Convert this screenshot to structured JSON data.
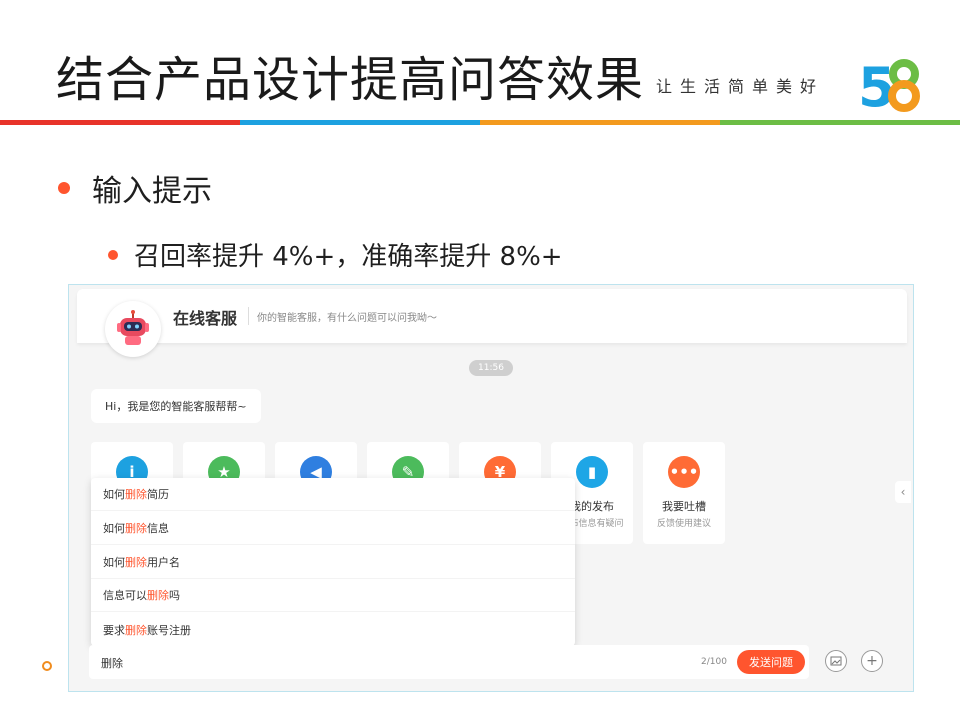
{
  "header": {
    "title": "结合产品设计提高问答效果",
    "tagline": "让生活简单美好",
    "logo_text": "58"
  },
  "colors": {
    "accent": "#ff552e",
    "rainbow": [
      "#e8332a",
      "#1da1e0",
      "#f39a1e",
      "#6cbd45"
    ]
  },
  "bullets": {
    "level1": "输入提示",
    "level2": "召回率提升 4%+，准确率提升 8%+"
  },
  "chat": {
    "title": "在线客服",
    "subtitle": "你的智能客服，有什么问题可以问我呦～",
    "avatar_icon": "robot-icon",
    "time": "11:56",
    "greeting": "Hi，我是您的智能客服帮帮~",
    "cards": [
      {
        "title": "",
        "sub": "",
        "icon": "info-icon",
        "color": "#1da1e0"
      },
      {
        "title": "",
        "sub": "",
        "icon": "star-icon",
        "color": "#4cbb5c"
      },
      {
        "title": "",
        "sub": "",
        "icon": "speaker-icon",
        "color": "#2f7fe0"
      },
      {
        "title": "",
        "sub": "",
        "icon": "pencil-icon",
        "color": "#4cbb5c"
      },
      {
        "title": "",
        "sub": "",
        "icon": "yuan-icon",
        "color": "#ff6b35"
      },
      {
        "title": "我的发布",
        "sub": "发布信息有疑问",
        "icon": "document-icon",
        "color": "#1ea6e6"
      },
      {
        "title": "我要吐槽",
        "sub": "反馈使用建议",
        "icon": "chat-bubble-icon",
        "color": "#ff6b35"
      }
    ],
    "suggestions": [
      {
        "pre": "如何",
        "hl": "删除",
        "post": "简历"
      },
      {
        "pre": "如何",
        "hl": "删除",
        "post": "信息"
      },
      {
        "pre": "如何",
        "hl": "删除",
        "post": "用户名"
      },
      {
        "pre": "信息可以",
        "hl": "删除",
        "post": "吗"
      },
      {
        "pre": "要求",
        "hl": "删除",
        "post": "账号注册"
      }
    ],
    "input_value": "删除",
    "counter": "2/100",
    "send_label": "发送问题",
    "image_icon": "image-icon",
    "plus_icon": "plus-icon",
    "side_arrow": "‹"
  }
}
